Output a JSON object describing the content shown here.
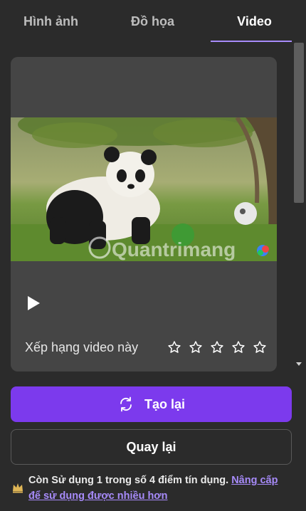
{
  "tabs": [
    {
      "label": "Hình ảnh",
      "active": false
    },
    {
      "label": "Đồ họa",
      "active": false
    },
    {
      "label": "Video",
      "active": true
    }
  ],
  "video": {
    "watermark": "Quantrimang",
    "play_icon": "play-icon"
  },
  "rating": {
    "label": "Xếp hạng video này",
    "max_stars": 5,
    "value": 0
  },
  "actions": {
    "regenerate_label": "Tạo lại",
    "regenerate_icon": "refresh-icon",
    "back_label": "Quay lại"
  },
  "credits": {
    "text": "Còn Sử dụng 1 trong số 4 điểm tín dụng. ",
    "link": "Nâng cấp để sử dụng được nhiều hơn",
    "icon": "crown-icon"
  },
  "colors": {
    "accent": "#7c3aed",
    "link": "#a78bfa",
    "background": "#2b2b2b",
    "card": "#454545"
  }
}
